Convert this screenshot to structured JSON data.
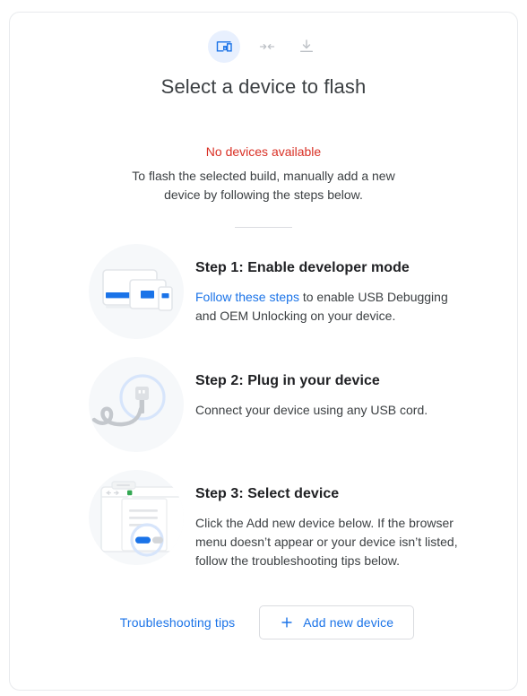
{
  "header": {
    "icons": [
      {
        "name": "devices-icon",
        "state": "active"
      },
      {
        "name": "connect-arrows-icon",
        "state": "inactive"
      },
      {
        "name": "download-icon",
        "state": "inactive"
      }
    ],
    "title": "Select a device to flash"
  },
  "status": {
    "error": "No devices available",
    "description": "To flash the selected build, manually add a new device by following the steps below."
  },
  "steps": [
    {
      "title": "Step 1: Enable developer mode",
      "link_text": "Follow these steps",
      "text_after_link": " to enable USB Debugging and OEM Unlocking on your device.",
      "art": "devices-illustration"
    },
    {
      "title": "Step 2: Plug in your device",
      "link_text": "",
      "text_after_link": "Connect your device using any USB cord.",
      "art": "usb-cable-illustration"
    },
    {
      "title": "Step 3: Select device",
      "link_text": "",
      "text_after_link": "Click the Add new device below. If the browser menu doesn’t appear or your device isn’t listed, follow the troubleshooting tips below.",
      "art": "browser-dialog-illustration"
    }
  ],
  "footer": {
    "troubleshooting_label": "Troubleshooting tips",
    "add_device_label": "Add new device",
    "add_device_icon": "plus-icon"
  },
  "colors": {
    "accent_blue": "#1a73e8",
    "error_red": "#d93025",
    "icon_bg_blue": "#e8f0fe",
    "art_bg_gray": "#f6f8fa",
    "border_gray": "#dadce0",
    "text_primary": "#202124",
    "text_secondary": "#3c4043",
    "inactive_gray": "#bdc1c6"
  }
}
